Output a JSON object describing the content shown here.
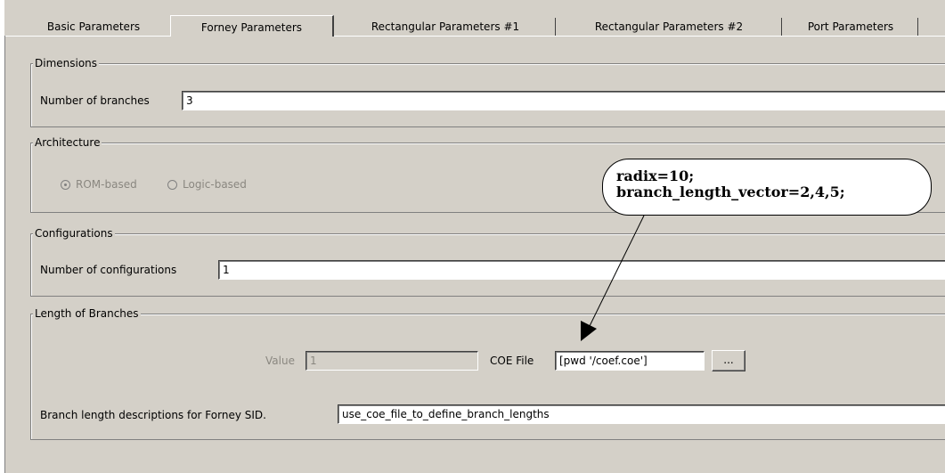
{
  "tabs": [
    {
      "label": "Basic Parameters",
      "active": false
    },
    {
      "label": "Forney Parameters",
      "active": true
    },
    {
      "label": "Rectangular Parameters #1",
      "active": false
    },
    {
      "label": "Rectangular Parameters #2",
      "active": false
    },
    {
      "label": "Port Parameters",
      "active": false
    }
  ],
  "dimensions": {
    "legend": "Dimensions",
    "branches_label": "Number of branches",
    "branches_value": "3"
  },
  "architecture": {
    "legend": "Architecture",
    "options": [
      {
        "label": "ROM-based",
        "selected": true
      },
      {
        "label": "Logic-based",
        "selected": false
      }
    ]
  },
  "configurations": {
    "legend": "Configurations",
    "count_label": "Number of configurations",
    "count_value": "1"
  },
  "length_of_branches": {
    "legend": "Length of Branches",
    "value_label": "Value",
    "value_value": "1",
    "coe_label": "COE File",
    "coe_value": "[pwd '/coef.coe']",
    "browse_label": "...",
    "descriptions_label": "Branch length descriptions for Forney SID.",
    "descriptions_value": "use_coe_file_to_define_branch_lengths"
  },
  "callout": {
    "line1": "radix=10;",
    "line2": "branch_length_vector=2,4,5;"
  }
}
